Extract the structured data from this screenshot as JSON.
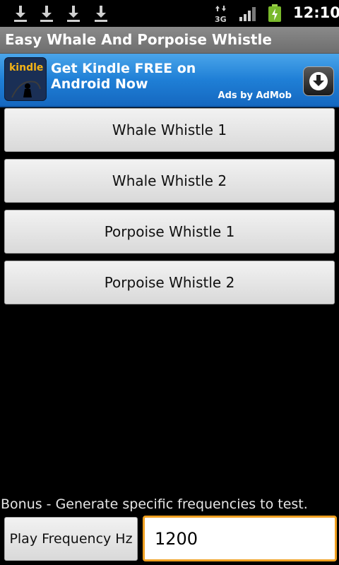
{
  "status_bar": {
    "time": "12:10",
    "network": "3G",
    "icons": [
      "download-icon",
      "download-icon",
      "download-icon",
      "download-icon",
      "3g-data-icon",
      "signal-bars-icon",
      "battery-charging-icon"
    ]
  },
  "app": {
    "title": "Easy Whale And Porpoise Whistle"
  },
  "ad": {
    "logo_text": "kindle",
    "headline": "Get Kindle FREE on Android Now",
    "attribution": "Ads by AdMob",
    "accent": "#1f7fd6"
  },
  "buttons": [
    {
      "label": "Whale Whistle 1"
    },
    {
      "label": "Whale Whistle 2"
    },
    {
      "label": "Porpoise Whistle 1"
    },
    {
      "label": "Porpoise Whistle 2"
    }
  ],
  "bonus": {
    "text": "Bonus - Generate specific frequencies to test.",
    "play_label": "Play Frequency Hz",
    "frequency_value": "1200",
    "focus_color": "#f0a020"
  }
}
